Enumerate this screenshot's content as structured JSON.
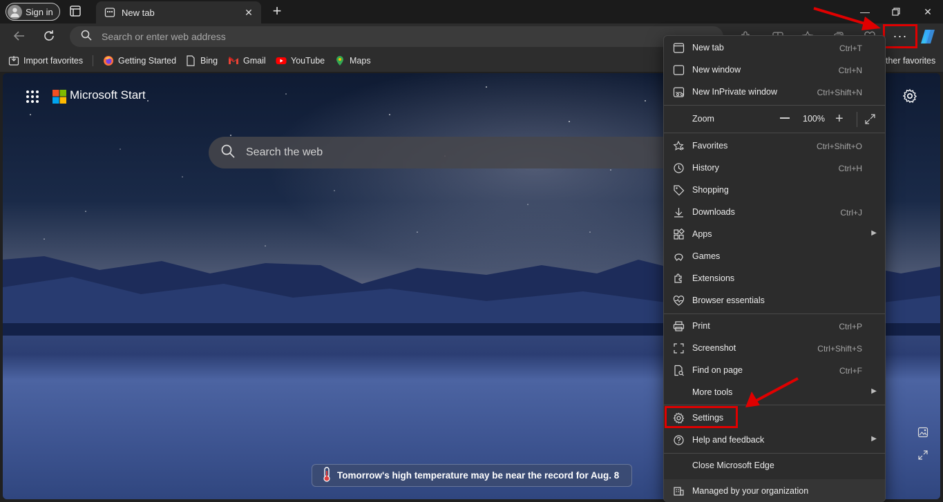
{
  "tabstrip": {
    "signin_label": "Sign in",
    "tab_title": "New tab"
  },
  "toolbar": {
    "address_placeholder": "Search or enter web address",
    "more_button_label": "···"
  },
  "favorites": {
    "items": [
      {
        "label": "Import favorites",
        "icon": "import-icon"
      },
      {
        "label": "Getting Started",
        "icon": "firefox-icon"
      },
      {
        "label": "Bing",
        "icon": "page-icon"
      },
      {
        "label": "Gmail",
        "icon": "gmail-icon"
      },
      {
        "label": "YouTube",
        "icon": "youtube-icon"
      },
      {
        "label": "Maps",
        "icon": "maps-pin-icon"
      }
    ],
    "other_label": "ther favorites"
  },
  "start": {
    "brand": "Microsoft Start",
    "search_placeholder": "Search the web",
    "weather_text": "Tomorrow's high temperature may be near the record for Aug. 8"
  },
  "menu": {
    "new_tab": {
      "label": "New tab",
      "shortcut": "Ctrl+T"
    },
    "new_window": {
      "label": "New window",
      "shortcut": "Ctrl+N"
    },
    "inprivate": {
      "label": "New InPrivate window",
      "shortcut": "Ctrl+Shift+N"
    },
    "zoom": {
      "label": "Zoom",
      "value": "100%"
    },
    "favorites": {
      "label": "Favorites",
      "shortcut": "Ctrl+Shift+O"
    },
    "history": {
      "label": "History",
      "shortcut": "Ctrl+H"
    },
    "shopping": {
      "label": "Shopping"
    },
    "downloads": {
      "label": "Downloads",
      "shortcut": "Ctrl+J"
    },
    "apps": {
      "label": "Apps"
    },
    "games": {
      "label": "Games"
    },
    "extensions": {
      "label": "Extensions"
    },
    "essentials": {
      "label": "Browser essentials"
    },
    "print": {
      "label": "Print",
      "shortcut": "Ctrl+P"
    },
    "screenshot": {
      "label": "Screenshot",
      "shortcut": "Ctrl+Shift+S"
    },
    "find": {
      "label": "Find on page",
      "shortcut": "Ctrl+F"
    },
    "more_tools": {
      "label": "More tools"
    },
    "settings": {
      "label": "Settings"
    },
    "help": {
      "label": "Help and feedback"
    },
    "close": {
      "label": "Close Microsoft Edge"
    },
    "managed": {
      "label": "Managed by your organization"
    }
  },
  "colors": {
    "highlight": "#e00000",
    "menu_bg": "#2c2c2c",
    "toolbar_bg": "#2d2d2d"
  }
}
